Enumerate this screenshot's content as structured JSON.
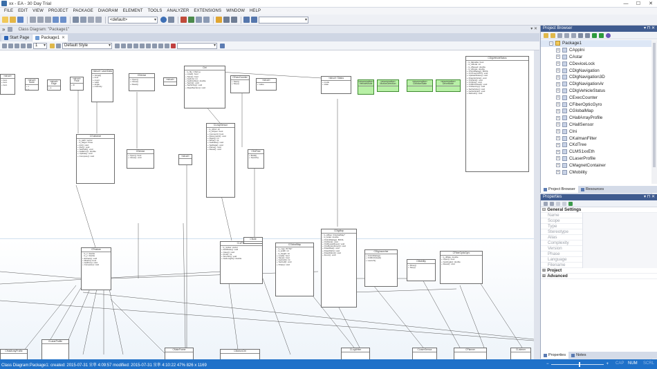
{
  "window": {
    "title": "xx - EA - 30 Day Trial",
    "minimize": "—",
    "maximize": "☐",
    "close": "✕"
  },
  "menu": [
    "FILE",
    "EDIT",
    "VIEW",
    "PROJECT",
    "PACKAGE",
    "DIAGRAM",
    "ELEMENT",
    "TOOLS",
    "ANALYZER",
    "EXTENSIONS",
    "WINDOW",
    "HELP"
  ],
  "toolbar": {
    "perspective_select": "<default>",
    "search_box": ""
  },
  "document": {
    "path": "Class Diagram: \"Package1\"",
    "expand_glyph": "»"
  },
  "tabs": [
    {
      "label": "Start Page"
    },
    {
      "label": "Package1",
      "close": "✕"
    }
  ],
  "diagram_toolbar": {
    "zoom_value": "1",
    "style_select": "Default Style",
    "filter_box": ""
  },
  "diagram": {
    "classes": [
      {
        "title": "CDlgVehicleStatus"
      },
      {
        "title": "CGuidance"
      },
      {
        "title": "CDevice"
      },
      {
        "title": "CLeapSensor"
      },
      {
        "title": "CMotionCtrl"
      },
      {
        "title": "CFiberOpticGyro"
      },
      {
        "title": "CFeature"
      },
      {
        "title": "CLsPath"
      },
      {
        "title": "CGlobalMap"
      },
      {
        "title": "CDlgMap"
      },
      {
        "title": "CMainFrame"
      },
      {
        "title": "CLaserProfile"
      },
      {
        "title": "CHallArrayProfile"
      }
    ],
    "green_notes": [
      "«enumeration»\nVehicleMode",
      "«enumeration»\nMotionDirection",
      "«enumeration»\nCMotionState",
      "«enumeration»\nDriveMode"
    ]
  },
  "project_browser": {
    "title": "Project Browser",
    "items": [
      {
        "label": "Package1",
        "selected": true,
        "root": true
      },
      {
        "label": "CApplni"
      },
      {
        "label": "CAstar"
      },
      {
        "label": "CDeviceLock"
      },
      {
        "label": "CDlgNavigation"
      },
      {
        "label": "CDlgNavigation3D"
      },
      {
        "label": "CDlgNavigationAr"
      },
      {
        "label": "CDlgVehicleStatus"
      },
      {
        "label": "CExecCounter"
      },
      {
        "label": "CFiberOpticGyro"
      },
      {
        "label": "CGlobalMap"
      },
      {
        "label": "CHallArrayProfile"
      },
      {
        "label": "CHallSensor"
      },
      {
        "label": "CIni"
      },
      {
        "label": "CKalmanFilter"
      },
      {
        "label": "CKdTree"
      },
      {
        "label": "CLMS1xxEth"
      },
      {
        "label": "CLaserProfile"
      },
      {
        "label": "CMagnetContainer"
      },
      {
        "label": "CMobility"
      }
    ],
    "tabs": [
      "Project Browser",
      "Resources"
    ]
  },
  "properties": {
    "title": "Properties",
    "sections": [
      {
        "label": "General Settings",
        "type": "section",
        "expand": "⊟"
      },
      {
        "label": "Name"
      },
      {
        "label": "Scope"
      },
      {
        "label": "Type"
      },
      {
        "label": "Stereotype"
      },
      {
        "label": "Alias"
      },
      {
        "label": "Complexity"
      },
      {
        "label": "Version"
      },
      {
        "label": "Phase"
      },
      {
        "label": "Language"
      },
      {
        "label": "Filename"
      },
      {
        "label": "Project",
        "type": "section",
        "expand": "⊞"
      },
      {
        "label": "Advanced",
        "type": "section",
        "expand": "⊞"
      }
    ],
    "tabs": [
      "Properties",
      "Notes"
    ]
  },
  "status_bar": {
    "text": "Class Diagram:Package1:  created: 2015-07-31 오후 4:09:57  modified: 2015-07-31 오후 4:10:22   47%   826 x 1169",
    "zoom_minus": "−",
    "zoom_plus": "+",
    "caps": "CAP",
    "num": "NUM",
    "scrl": "SCRL"
  },
  "colors": {
    "accent": "#1f71c9",
    "panel_header": "#3f5b8f",
    "enum_note": "#b8f0a6"
  }
}
